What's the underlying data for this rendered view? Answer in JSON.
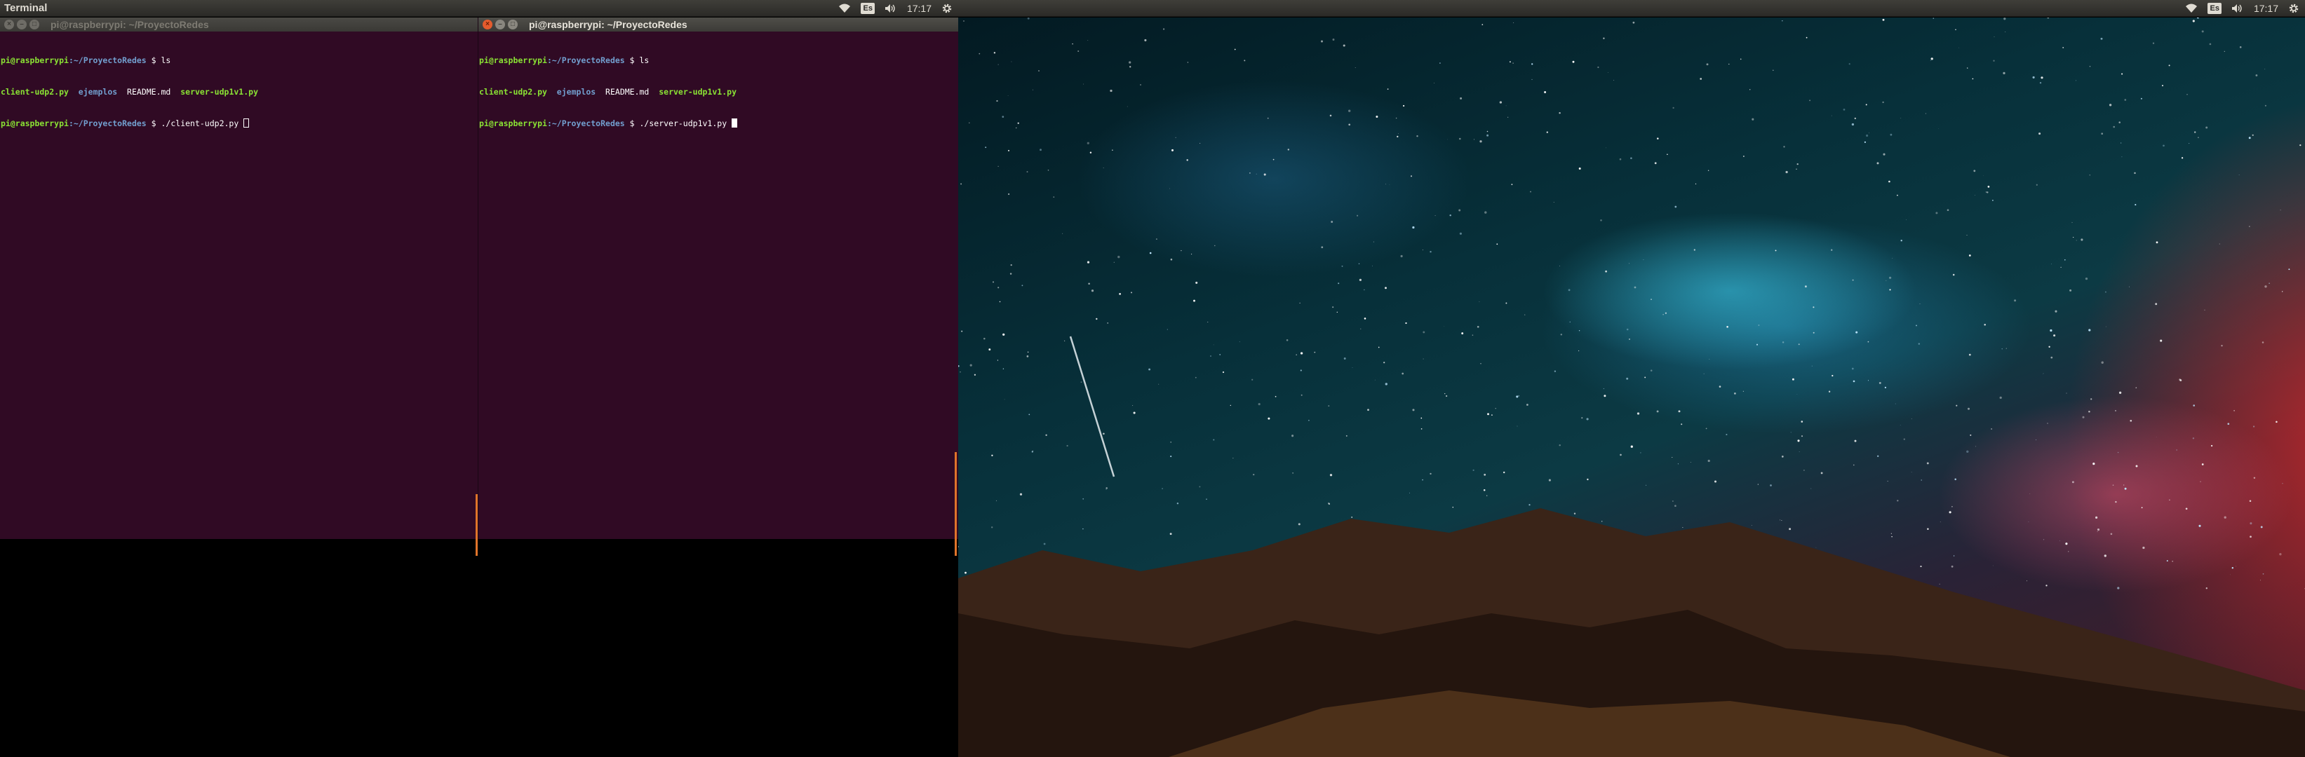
{
  "left_panel": {
    "app_title": "Terminal",
    "keyboard_layout": "Es",
    "clock": "17:17"
  },
  "right_panel": {
    "keyboard_layout": "Es",
    "clock": "17:17"
  },
  "icons": {
    "network": "wifi-icon",
    "volume": "volume-icon",
    "settings": "gear-icon"
  },
  "terminal_left": {
    "title": "pi@raspberrypi: ~/ProyectoRedes",
    "active": false,
    "lines": [
      {
        "prompt_user": "pi@raspberrypi",
        "prompt_path": ":~/ProyectoRedes",
        "prompt_sym": " $ ",
        "command": "ls"
      },
      {
        "files": [
          "client-udp2.py",
          "ejemplos",
          "README.md",
          "server-udp1v1.py"
        ]
      },
      {
        "prompt_user": "pi@raspberrypi",
        "prompt_path": ":~/ProyectoRedes",
        "prompt_sym": " $ ",
        "command": "./client-udp2.py "
      }
    ]
  },
  "terminal_right": {
    "title": "pi@raspberrypi: ~/ProyectoRedes",
    "active": true,
    "lines": [
      {
        "prompt_user": "pi@raspberrypi",
        "prompt_path": ":~/ProyectoRedes",
        "prompt_sym": " $ ",
        "command": "ls"
      },
      {
        "files": [
          "client-udp2.py",
          "ejemplos",
          "README.md",
          "server-udp1v1.py"
        ]
      },
      {
        "prompt_user": "pi@raspberrypi",
        "prompt_path": ":~/ProyectoRedes",
        "prompt_sym": " $ ",
        "command": "./server-udp1v1.py "
      }
    ]
  },
  "colors": {
    "terminal_bg": "#300a24",
    "prompt_user": "#8ae234",
    "prompt_path": "#729fcf",
    "close_button": "#e55b2d",
    "panel_bg": "#3c3b37"
  }
}
